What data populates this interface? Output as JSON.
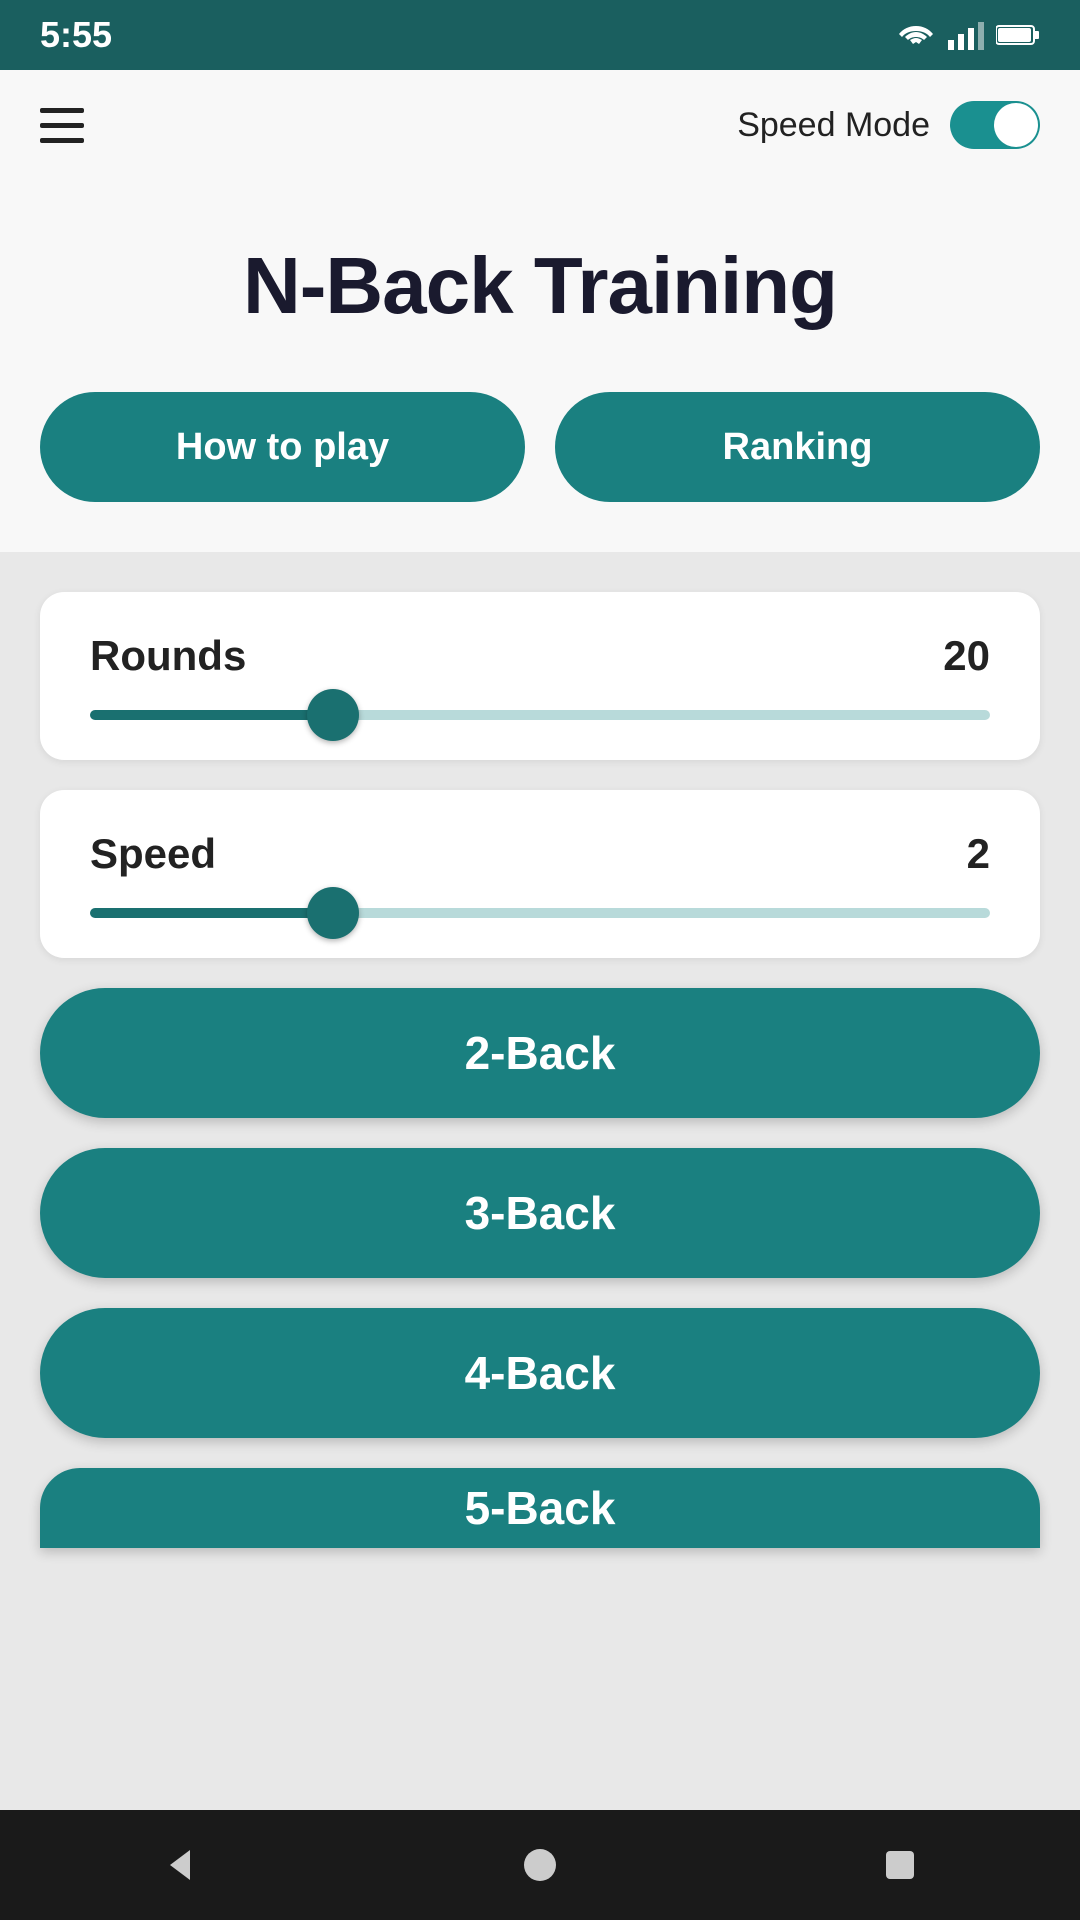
{
  "statusBar": {
    "time": "5:55"
  },
  "topBar": {
    "speedModeLabel": "Speed Mode",
    "toggleEnabled": true
  },
  "hero": {
    "title": "N-Back Training",
    "howToPlayLabel": "How to play",
    "rankingLabel": "Ranking"
  },
  "roundsSlider": {
    "label": "Rounds",
    "value": "20",
    "percentage": 27
  },
  "speedSlider": {
    "label": "Speed",
    "value": "2",
    "percentage": 27
  },
  "gameButtons": [
    {
      "label": "2-Back"
    },
    {
      "label": "3-Back"
    },
    {
      "label": "4-Back"
    },
    {
      "label": "5-Back"
    }
  ],
  "navBar": {
    "backIcon": "◀",
    "homeIcon": "●",
    "recentIcon": "■"
  },
  "colors": {
    "primary": "#1a8080",
    "dark": "#1a1a2e",
    "statusBarBg": "#1a5f5f"
  }
}
